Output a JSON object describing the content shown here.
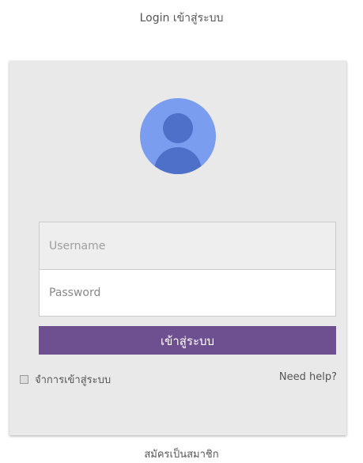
{
  "page": {
    "title": "Login เข้าสู่ระบบ"
  },
  "form": {
    "avatar_icon": "user-avatar-icon",
    "username_placeholder": "Username",
    "password_placeholder": "Password",
    "submit_label": "เข้าสู่ระบบ",
    "remember_label": "จำการเข้าสู่ระบบ",
    "remember_checked": false,
    "help_label": "Need help?"
  },
  "footer": {
    "register_label": "สมัครเป็นสมาชิก"
  },
  "colors": {
    "card_background": "#e9e9e9",
    "avatar_background": "#7a9df0",
    "avatar_figure": "#4e70c9",
    "submit_background": "#6e4f8f",
    "submit_text": "#ffffff"
  }
}
